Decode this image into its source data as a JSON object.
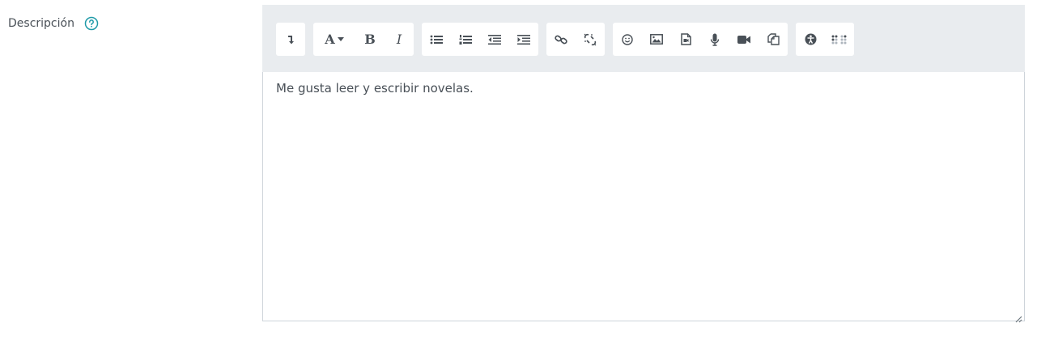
{
  "field": {
    "label": "Descripción",
    "help_icon": "question-circle-icon"
  },
  "editor": {
    "content": "Me gusta leer y escribir novelas."
  },
  "toolbar": {
    "collapse_icon": "collapse-arrow-icon",
    "font_style_label": "A",
    "bold_label": "B",
    "italic_label": "I",
    "icons": [
      "unordered-list-icon",
      "ordered-list-icon",
      "outdent-icon",
      "indent-icon",
      "link-icon",
      "unlink-icon",
      "emoji-icon",
      "image-icon",
      "media-icon",
      "record-audio-icon",
      "record-video-icon",
      "manage-files-icon",
      "accessibility-checker-icon",
      "screenreader-helper-icon"
    ]
  },
  "colors": {
    "accent": "#1f9aa8",
    "toolbar_bg": "#e9ecef",
    "icon": "#495057"
  }
}
